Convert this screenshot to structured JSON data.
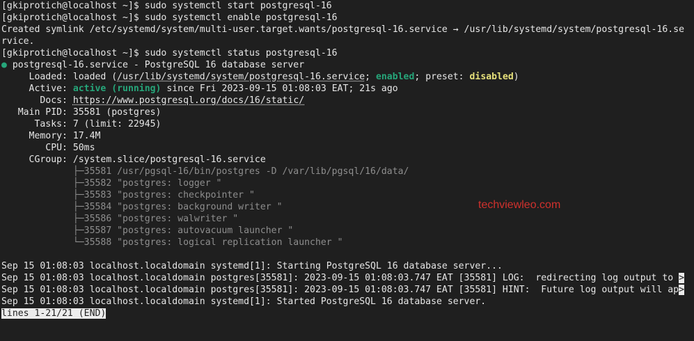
{
  "terminal": {
    "lines": [
      [
        {
          "t": "[gkiprotich@localhost ~]$ sudo systemctl start postgresql-16"
        }
      ],
      [
        {
          "t": "[gkiprotich@localhost ~]$ sudo systemctl enable postgresql-16"
        }
      ],
      [
        {
          "t": "Created symlink /etc/systemd/system/multi-user.target.wants/postgresql-16.service → /usr/lib/systemd/system/postgresql-16.se"
        }
      ],
      [
        {
          "t": "rvice."
        }
      ],
      [
        {
          "t": "[gkiprotich@localhost ~]$ sudo systemctl status postgresql-16"
        }
      ],
      [
        {
          "t": "●",
          "c": "dot"
        },
        {
          "t": " postgresql-16.service - PostgreSQL 16 database server"
        }
      ],
      [
        {
          "t": "     Loaded: loaded ("
        },
        {
          "t": "/usr/lib/systemd/system/postgresql-16.service",
          "c": "ul"
        },
        {
          "t": "; "
        },
        {
          "t": "enabled",
          "c": "green"
        },
        {
          "t": "; preset: "
        },
        {
          "t": "disabled",
          "c": "yellow"
        },
        {
          "t": ")"
        }
      ],
      [
        {
          "t": "     Active: "
        },
        {
          "t": "active (running)",
          "c": "green"
        },
        {
          "t": " since Fri 2023-09-15 01:08:03 EAT; 21s ago"
        }
      ],
      [
        {
          "t": "       Docs: "
        },
        {
          "t": "https://www.postgresql.org/docs/16/static/",
          "c": "ul"
        }
      ],
      [
        {
          "t": "   Main PID: 35581 (postgres)"
        }
      ],
      [
        {
          "t": "      Tasks: 7 (limit: 22945)"
        }
      ],
      [
        {
          "t": "     Memory: 17.4M"
        }
      ],
      [
        {
          "t": "        CPU: 50ms"
        }
      ],
      [
        {
          "t": "     CGroup: /system.slice/postgresql-16.service"
        }
      ],
      [
        {
          "t": "             ├─35581 /usr/pgsql-16/bin/postgres -D /var/lib/pgsql/16/data/",
          "c": "gray"
        }
      ],
      [
        {
          "t": "             ├─35582 \"postgres: logger \"",
          "c": "gray"
        }
      ],
      [
        {
          "t": "             ├─35583 \"postgres: checkpointer \"",
          "c": "gray"
        }
      ],
      [
        {
          "t": "             ├─35584 \"postgres: background writer \"",
          "c": "gray"
        }
      ],
      [
        {
          "t": "             ├─35586 \"postgres: walwriter \"",
          "c": "gray"
        }
      ],
      [
        {
          "t": "             ├─35587 \"postgres: autovacuum launcher \"",
          "c": "gray"
        }
      ],
      [
        {
          "t": "             └─35588 \"postgres: logical replication launcher \"",
          "c": "gray"
        }
      ],
      [],
      [
        {
          "t": "Sep 15 01:08:03 localhost.localdomain systemd[1]: Starting PostgreSQL 16 database server..."
        }
      ],
      [
        {
          "t": "Sep 15 01:08:03 localhost.localdomain postgres[35581]: 2023-09-15 01:08:03.747 EAT [35581] LOG:  redirecting log output to "
        },
        {
          "t": ">",
          "c": "inv"
        }
      ],
      [
        {
          "t": "Sep 15 01:08:03 localhost.localdomain postgres[35581]: 2023-09-15 01:08:03.747 EAT [35581] HINT:  Future log output will ap"
        },
        {
          "t": ">",
          "c": "inv"
        }
      ],
      [
        {
          "t": "Sep 15 01:08:03 localhost.localdomain systemd[1]: Started PostgreSQL 16 database server."
        }
      ],
      [
        {
          "t": "lines 1-21/21 (END)",
          "c": "inv"
        }
      ]
    ]
  },
  "watermark": "techviewleo.com"
}
